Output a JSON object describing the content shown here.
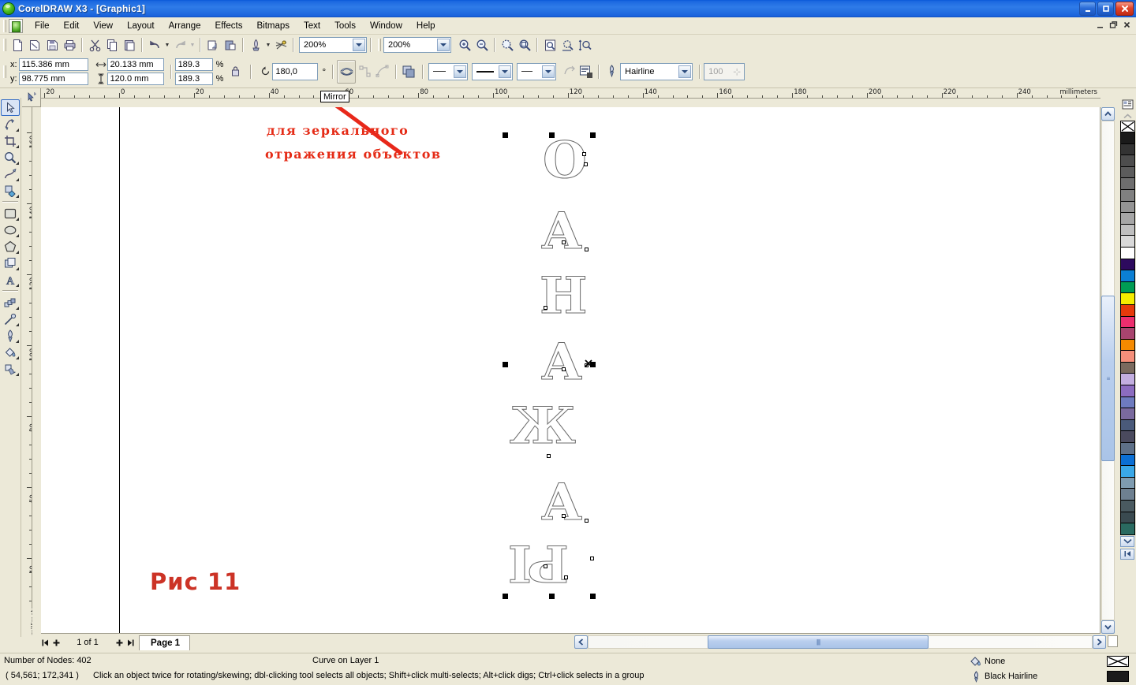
{
  "window": {
    "title": "CorelDRAW X3 - [Graphic1]",
    "minimize": "_",
    "maximize": "□",
    "close": "✕"
  },
  "mdi_controls": {
    "minimize": "_",
    "restore": "❐",
    "close": "✕"
  },
  "menu": {
    "items": [
      {
        "label": "File"
      },
      {
        "label": "Edit"
      },
      {
        "label": "View"
      },
      {
        "label": "Layout"
      },
      {
        "label": "Arrange"
      },
      {
        "label": "Effects"
      },
      {
        "label": "Bitmaps"
      },
      {
        "label": "Text"
      },
      {
        "label": "Tools"
      },
      {
        "label": "Window"
      },
      {
        "label": "Help"
      }
    ]
  },
  "toolbar": {
    "zoom_level": "200%",
    "zoom_level_2": "200%",
    "buttons": [
      "new-icon",
      "open-icon",
      "save-icon",
      "print-icon",
      "cut-icon",
      "copy-icon",
      "paste-icon",
      "undo-icon",
      "redo-icon",
      "import-icon",
      "export-icon",
      "application-launcher-icon",
      "corel-online-icon",
      "zoom-in-icon",
      "zoom-out-icon",
      "zoom-to-selection-icon",
      "zoom-to-all-objects-icon",
      "zoom-to-page-icon",
      "zoom-to-page-width-icon",
      "zoom-to-page-height-icon"
    ]
  },
  "propertybar": {
    "x_label": "x:",
    "y_label": "y:",
    "x_value": "115.386 mm",
    "y_value": "98.775 mm",
    "width_value": "20.133 mm",
    "height_value": "120.0 mm",
    "scale_h": "189.3",
    "scale_v": "189.3",
    "percent_sign": "%",
    "lock_icon": "lock-ratio-icon",
    "angle_value": "180,0",
    "angle_unit": "°",
    "mirror_icon": "mirror-icon",
    "mirror_tooltip": "Mirror",
    "outline_width": "Hairline",
    "transparency_value": "100",
    "dash_style": "—",
    "line_thickness": "—",
    "arrow_style": "—"
  },
  "ruler": {
    "unit_label": "millimeters",
    "h_labels": [
      "20",
      "0",
      "20",
      "40",
      "60",
      "80",
      "100",
      "120",
      "140",
      "160",
      "180",
      "200",
      "220",
      "240"
    ],
    "v_labels": [
      "160",
      "140",
      "120",
      "100",
      "80",
      "60",
      "40"
    ],
    "v_unit": "millimeters"
  },
  "toolbox": {
    "tools": [
      {
        "name": "pick-tool-icon",
        "glyph": "➤",
        "active": true
      },
      {
        "name": "shape-tool-icon",
        "glyph": "✎",
        "active": false
      },
      {
        "name": "crop-tool-icon",
        "glyph": "✄",
        "active": false
      },
      {
        "name": "zoom-tool-icon",
        "glyph": "🔍",
        "active": false
      },
      {
        "name": "freehand-tool-icon",
        "glyph": "✒",
        "active": false
      },
      {
        "name": "smart-fill-tool-icon",
        "glyph": "◈",
        "active": false
      },
      {
        "name": "rectangle-tool-icon",
        "glyph": "▭",
        "active": false
      },
      {
        "name": "ellipse-tool-icon",
        "glyph": "◯",
        "active": false
      },
      {
        "name": "polygon-tool-icon",
        "glyph": "⬟",
        "active": false
      },
      {
        "name": "basic-shapes-tool-icon",
        "glyph": "❏",
        "active": false
      },
      {
        "name": "text-tool-icon",
        "glyph": "A",
        "active": false
      },
      {
        "name": "interactive-blend-tool-icon",
        "glyph": "❖",
        "active": false
      },
      {
        "name": "eyedropper-tool-icon",
        "glyph": "⌇",
        "active": false
      },
      {
        "name": "outline-tool-icon",
        "glyph": "✑",
        "active": false
      },
      {
        "name": "fill-tool-icon",
        "glyph": "◨",
        "active": false
      },
      {
        "name": "interactive-fill-tool-icon",
        "glyph": "◧",
        "active": false
      }
    ]
  },
  "canvas": {
    "annotation_line1": "для зеркального",
    "annotation_line2": "отражения объектов",
    "figure_caption": "Рис 11",
    "letters": [
      "О",
      "А",
      "Н",
      "А",
      "Ж",
      "А",
      "Ы"
    ],
    "annotation_color": "#e52b16",
    "caption_color": "#cc3326"
  },
  "pagenav": {
    "first": "◀",
    "add_prev": "✚",
    "counter": "1 of 1",
    "add_next": "✚",
    "last": "▶",
    "tab_label": "Page 1"
  },
  "statusbar": {
    "nodes": "Number of Nodes: 402",
    "object_info": "Curve on Layer 1",
    "coordinates": "( 54,561; 172,341 )",
    "hint": "Click an object twice for rotating/skewing; dbl-clicking tool selects all objects; Shift+click multi-selects; Alt+click digs; Ctrl+click selects in a group",
    "fill_label": "None",
    "outline_label": "Black  Hairline",
    "fill_icon": "fill-bucket-icon",
    "outline_icon": "outline-pen-icon"
  },
  "palette": {
    "no_color_label": "none-swatch",
    "colors": [
      "#1a1a1a",
      "#333333",
      "#4d4d4d",
      "#5c5c5c",
      "#6e6e6e",
      "#808080",
      "#949494",
      "#a6a6a6",
      "#bfbfbf",
      "#d9d9d9",
      "#ffffff",
      "#2d0a5e",
      "#0b7fd4",
      "#009c54",
      "#f5ec00",
      "#e63a0b",
      "#ec2e6e",
      "#a8446e",
      "#f58a00",
      "#f58f7a",
      "#7a6a5e",
      "#c3aee0",
      "#8c6cc0",
      "#6e7bbf",
      "#7a6a9e",
      "#4a5a7a",
      "#4a4a5e",
      "#5e7088",
      "#0b6fd4",
      "#3aa8e8",
      "#7f9cb0",
      "#6e8090",
      "#4a5a60",
      "#3a4a50",
      "#2a6a60"
    ],
    "scroll_up": "▲",
    "scroll_down": "▼",
    "scroll_end": "◀"
  }
}
